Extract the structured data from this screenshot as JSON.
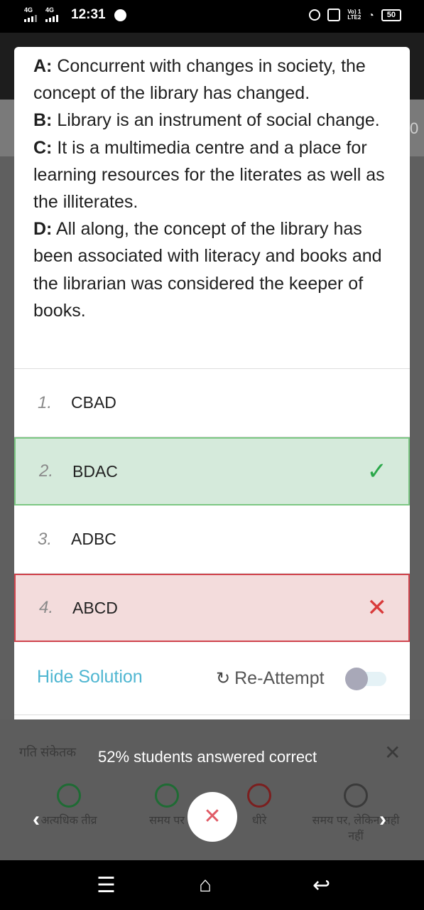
{
  "status_bar": {
    "network1": "4G",
    "network2": "4G",
    "time": "12:31",
    "volte": "Vo) 1\nLTE2",
    "battery": "50"
  },
  "background": {
    "edge_number": "0"
  },
  "question": {
    "statements": [
      {
        "key": "A:",
        "text": " Concurrent with changes in society, the concept of the library has changed."
      },
      {
        "key": "B:",
        "text": " Library is an instrument of social change."
      },
      {
        "key": "C:",
        "text": " It is a multimedia centre and a place for learning resources for the literates as well as the illiterates."
      },
      {
        "key": "D:",
        "text": " All along, the concept of the library has been associated with literacy and books and the librarian was considered the keeper of books."
      }
    ]
  },
  "options": [
    {
      "num": "1.",
      "text": "CBAD",
      "state": "neutral"
    },
    {
      "num": "2.",
      "text": "BDAC",
      "state": "correct",
      "mark": "check-icon"
    },
    {
      "num": "3.",
      "text": "ADBC",
      "state": "neutral"
    },
    {
      "num": "4.",
      "text": "ABCD",
      "state": "wrong",
      "mark": "cross-icon"
    }
  ],
  "solution_bar": {
    "hide_solution": "Hide Solution",
    "reattempt": "Re-Attempt",
    "reattempt_toggle_on": false
  },
  "feedback": {
    "speed_title": "गति संकेतक",
    "answered_text": "52% students answered correct",
    "speeds": [
      {
        "label": "अत्यधिक तीव्र",
        "icon": "fast-smiley-icon"
      },
      {
        "label": "समय पर",
        "icon": "ontime-smiley-icon"
      },
      {
        "label": "धीरे",
        "icon": "slow-smiley-icon"
      },
      {
        "label": "समय पर, लेकिन सही नहीं",
        "icon": "timer-smiley-icon"
      }
    ]
  },
  "colors": {
    "correct_bg": "#d5eadb",
    "correct_border": "#7cc783",
    "wrong_bg": "#f3dcdc",
    "wrong_border": "#d0444d",
    "link": "#4fb6d1"
  }
}
